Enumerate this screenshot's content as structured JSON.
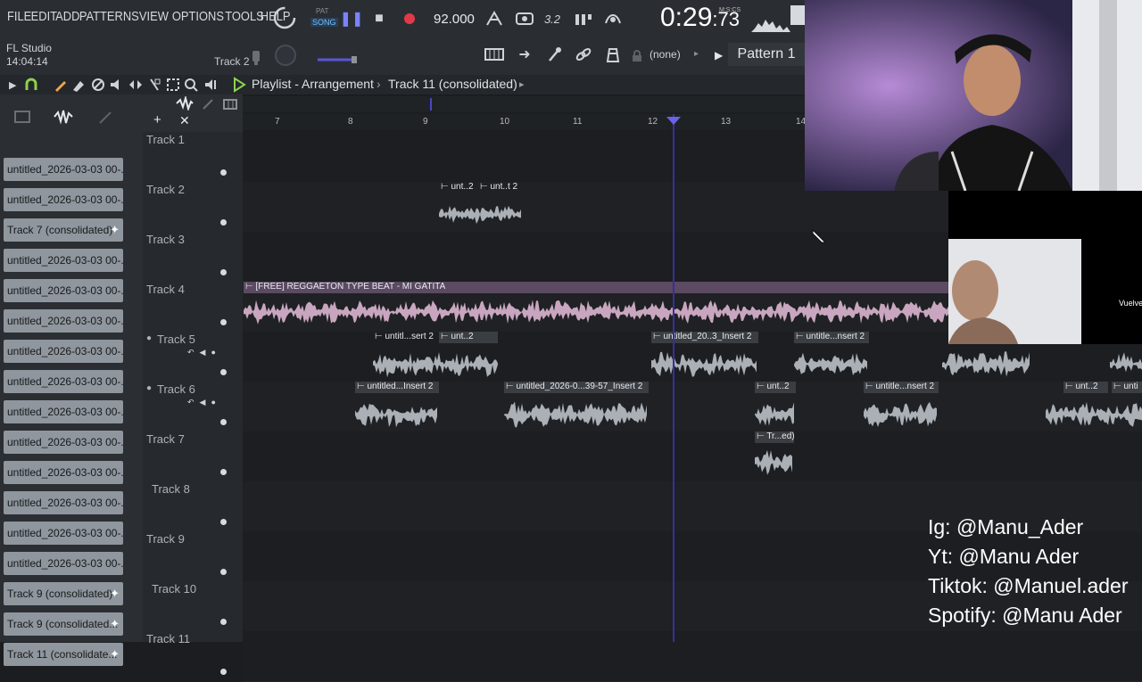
{
  "menu": {
    "items": [
      "FILE",
      "EDIT",
      "ADD",
      "PATTERNS",
      "VIEW",
      "OPTIONS",
      "TOOLS",
      "HELP"
    ]
  },
  "app": {
    "name": "FL Studio",
    "time": "14:04:14"
  },
  "transport": {
    "pat_label": "PAT",
    "song_label": "SONG",
    "tempo": "92.000",
    "clock_main": "0:29",
    "clock_frac": ":73",
    "clock_format": "M:S:CS",
    "beat_label": "3.2"
  },
  "toolbar2": {
    "track_label": "Track 2",
    "none_label": "(none)",
    "pattern_label": "Pattern 1"
  },
  "playlist": {
    "title": "Playlist - Arrangement",
    "separator": "›",
    "track": "Track 11 (consolidated)"
  },
  "browser": {
    "items": [
      {
        "label": "untitled_2026-03-03 00-...",
        "consolidated": false
      },
      {
        "label": "untitled_2026-03-03 00-...",
        "consolidated": false
      },
      {
        "label": "Track 7 (consolidated)",
        "consolidated": true
      },
      {
        "label": "untitled_2026-03-03 00-...",
        "consolidated": false
      },
      {
        "label": "untitled_2026-03-03 00-...",
        "consolidated": false
      },
      {
        "label": "untitled_2026-03-03 00-...",
        "consolidated": false
      },
      {
        "label": "untitled_2026-03-03 00-...",
        "consolidated": false
      },
      {
        "label": "untitled_2026-03-03 00-...",
        "consolidated": false
      },
      {
        "label": "untitled_2026-03-03 00-...",
        "consolidated": false
      },
      {
        "label": "untitled_2026-03-03 00-...",
        "consolidated": false
      },
      {
        "label": "untitled_2026-03-03 00-...",
        "consolidated": false
      },
      {
        "label": "untitled_2026-03-03 00-...",
        "consolidated": false
      },
      {
        "label": "untitled_2026-03-03 00-...",
        "consolidated": false
      },
      {
        "label": "untitled_2026-03-03 00-...",
        "consolidated": false
      },
      {
        "label": "Track 9 (consolidated)",
        "consolidated": true
      },
      {
        "label": "Track 9 (consolidated...",
        "consolidated": true
      },
      {
        "label": "Track 11 (consolidate...",
        "consolidated": true
      }
    ]
  },
  "ruler": {
    "marks": [
      "7",
      "8",
      "9",
      "10",
      "11",
      "12",
      "13",
      "14"
    ]
  },
  "tracks": [
    {
      "name": "Track 1"
    },
    {
      "name": "Track 2"
    },
    {
      "name": "Track 3"
    },
    {
      "name": "Track 4"
    },
    {
      "name": "Track 5"
    },
    {
      "name": "Track 6"
    },
    {
      "name": "Track 7"
    },
    {
      "name": "Track 8"
    },
    {
      "name": "Track 9"
    },
    {
      "name": "Track 10"
    },
    {
      "name": "Track 11"
    }
  ],
  "clips": {
    "t2a": "unt..2",
    "t2b": "unt..t 2",
    "t4": "[FREE] REGGAETON TYPE BEAT - MI GATITA",
    "t5a": "untitl...sert 2",
    "t5b": "unt..2",
    "t5c": "untitled_20..3_Insert 2",
    "t5d": "untitle...nsert 2",
    "t6a": "untitled...Insert 2",
    "t6b": "untitled_2026-0...39-57_Insert 2",
    "t6c": "unt..2",
    "t6d": "untitle...nsert 2",
    "t6e": "unt..2",
    "t6f": "unti",
    "t7a": "Tr...ed)"
  },
  "overlay": {
    "vuelve": "Vuelve"
  },
  "socials": {
    "ig": "Ig: @Manu_Ader",
    "yt": "Yt: @Manu Ader",
    "tiktok": "Tiktok: @Manuel.ader",
    "spotify": "Spotify: @Manu Ader"
  },
  "colors": {
    "accent_green": "#8fd14f",
    "clip_pink": "#c9a6bf",
    "clip_gray": "#aab0b6",
    "playhead": "#36309a",
    "record_red": "#e03a48"
  }
}
